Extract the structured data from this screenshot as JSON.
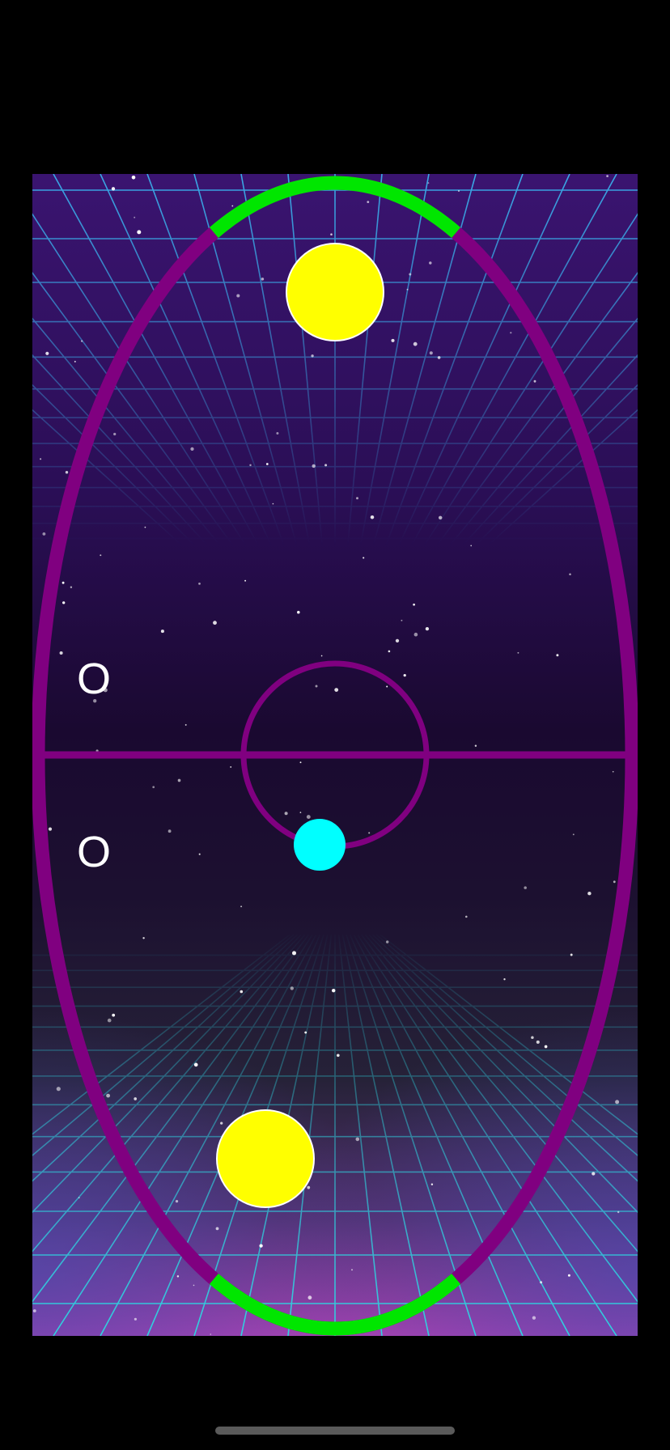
{
  "scores": {
    "top": "O",
    "bottom": "O"
  },
  "colors": {
    "screen_background": "#000000",
    "rink_boundary": "#800080",
    "goal_arc": "#00e600",
    "paddle": "#ffff00",
    "puck": "#00ffff",
    "grid_upper": "#3aa9e6",
    "grid_lower": "#2fd3e0",
    "sky_top": "#3a1470",
    "sky_mid": "#1a0930",
    "floor_bottom": "#b040b0",
    "home_indicator": "#5a5a5a"
  },
  "elements": {
    "rink": "oval-rink",
    "center_line": "center-line",
    "center_circle": "center-circle",
    "top_goal": "goal-arc-top",
    "bottom_goal": "goal-arc-bottom",
    "top_paddle": "opponent-paddle",
    "bottom_paddle": "player-paddle",
    "puck": "puck"
  }
}
